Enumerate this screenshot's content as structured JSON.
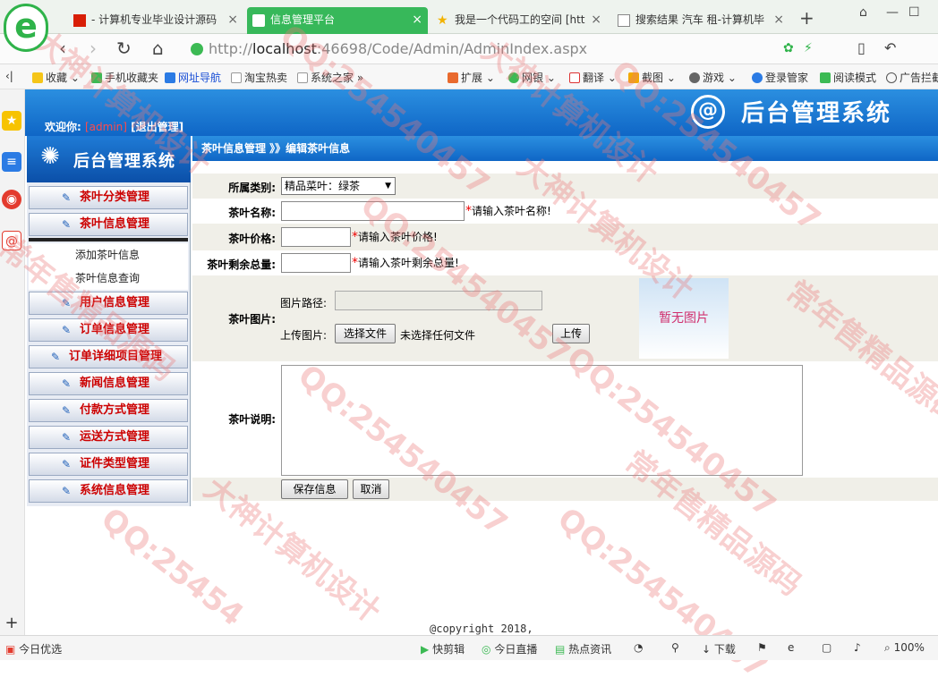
{
  "browser": {
    "logo_glyph": "e",
    "tabs": [
      {
        "label": "- 计算机专业毕业设计源码",
        "active": false
      },
      {
        "label": "信息管理平台",
        "active": true
      },
      {
        "label": "我是一个代码工的空间 [htt",
        "active": false
      },
      {
        "label": "搜索结果 汽车 租-计算机毕",
        "active": false
      }
    ],
    "new_tab_glyph": "+",
    "address": {
      "prefix": "http://",
      "host": "localhost",
      "path": ":46698/Code/Admin/AdminIndex.aspx"
    },
    "bookmarks": [
      "收藏",
      "手机收藏夹",
      "网址导航",
      "淘宝热卖",
      "系统之家"
    ],
    "toolbar_right": [
      "扩展",
      "网银",
      "翻译",
      "截图",
      "游戏",
      "登录管家",
      "阅读模式",
      "广告拦截"
    ],
    "status_left": "今日优选",
    "status_items": [
      "快剪辑",
      "今日直播",
      "热点资讯",
      "下载"
    ],
    "zoom": "100%"
  },
  "header": {
    "welcome_label": "欢迎你:",
    "username": "[admin]",
    "logout": "[退出管理]",
    "title": "后台管理系统",
    "logo_glyph": "@"
  },
  "sidebar": {
    "logo_text": "后台管理系统",
    "menu_top": [
      "茶叶分类管理",
      "茶叶信息管理"
    ],
    "sub_items": [
      "添加茶叶信息",
      "茶叶信息查询"
    ],
    "menu_bottom": [
      "用户信息管理",
      "订单信息管理",
      "订单详细项目管理",
      "新闻信息管理",
      "付款方式管理",
      "运送方式管理",
      "证件类型管理",
      "系统信息管理"
    ]
  },
  "breadcrumb": "茶叶信息管理 》》编辑茶叶信息",
  "form": {
    "category_label": "所属类别:",
    "category_value": "精品菜叶：绿茶",
    "name_label": "茶叶名称:",
    "name_hint": "请输入茶叶名称!",
    "price_label": "茶叶价格:",
    "price_hint": "请输入茶叶价格!",
    "stock_label": "茶叶剩余总量:",
    "stock_hint": "请输入茶叶剩余总量!",
    "image_label": "茶叶图片:",
    "image_path_label": "图片路径:",
    "upload_label": "上传图片:",
    "choose_file": "选择文件",
    "no_file": "未选择任何文件",
    "upload_btn": "上传",
    "no_image": "暂无图片",
    "desc_label": "茶叶说明:",
    "save_btn": "保存信息",
    "cancel_btn": "取消",
    "required_mark": "*"
  },
  "footer": {
    "copyright": "@copyright 2018,"
  },
  "watermark": {
    "texts": [
      "大神计算机设计",
      "QQ:254540457",
      "常年售精品源码",
      "QQ:25454",
      "大神计算机设计"
    ]
  }
}
